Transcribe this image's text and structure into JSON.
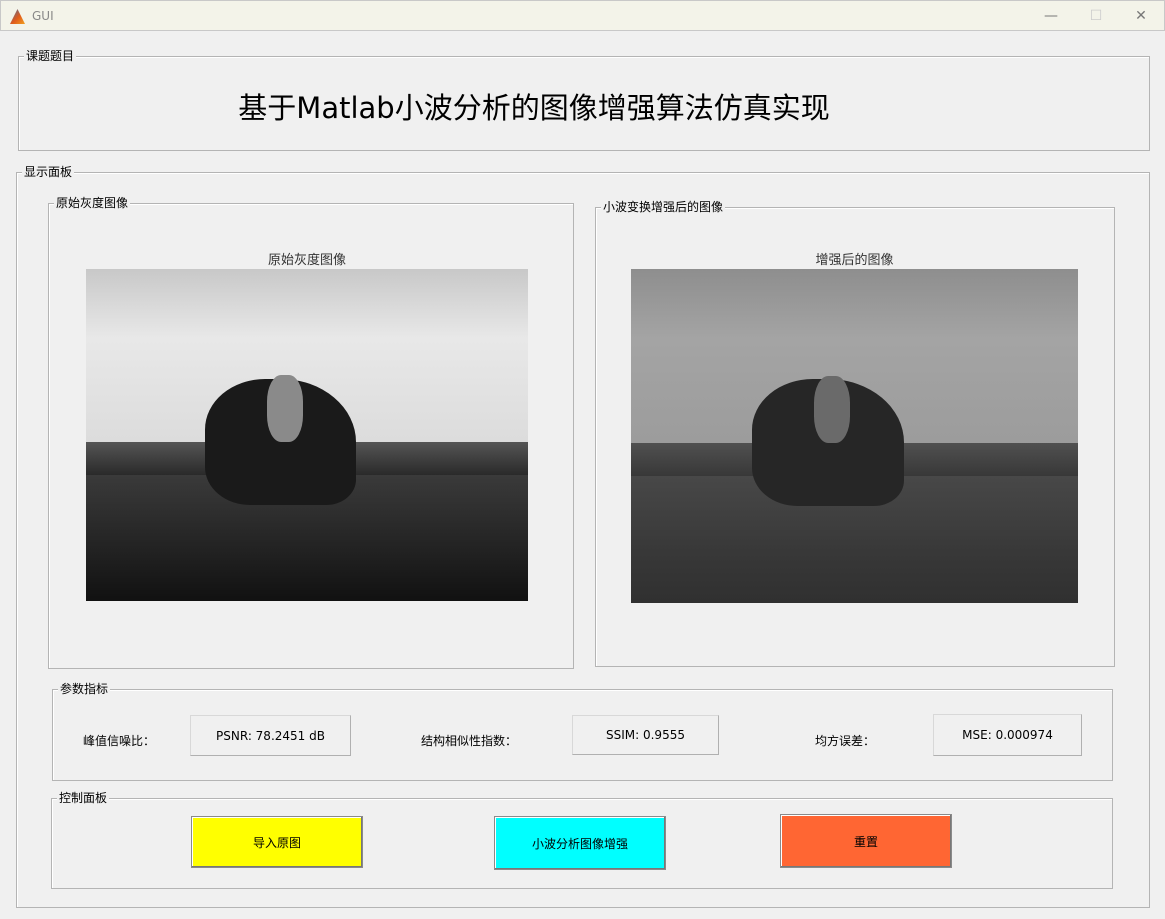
{
  "window": {
    "title": "GUI",
    "minimize": "—",
    "maximize": "☐",
    "close": "✕"
  },
  "topic_panel": {
    "label": "课题题目",
    "title": "基于Matlab小波分析的图像增强算法仿真实现"
  },
  "display_panel": {
    "label": "显示面板",
    "original": {
      "label": "原始灰度图像",
      "axes_title": "原始灰度图像"
    },
    "enhanced": {
      "label": "小波变换增强后的图像",
      "axes_title": "增强后的图像"
    }
  },
  "metrics_panel": {
    "label": "参数指标",
    "psnr_label": "峰值信噪比：",
    "psnr_value": "PSNR: 78.2451 dB",
    "ssim_label": "结构相似性指数：",
    "ssim_value": "SSIM: 0.9555",
    "mse_label": "均方误差：",
    "mse_value": "MSE: 0.000974"
  },
  "control_panel": {
    "label": "控制面板",
    "import_button": "导入原图",
    "enhance_button": "小波分析图像增强",
    "reset_button": "重置"
  },
  "colors": {
    "import": "#ffff00",
    "enhance": "#00ffff",
    "reset": "#ff6633"
  }
}
